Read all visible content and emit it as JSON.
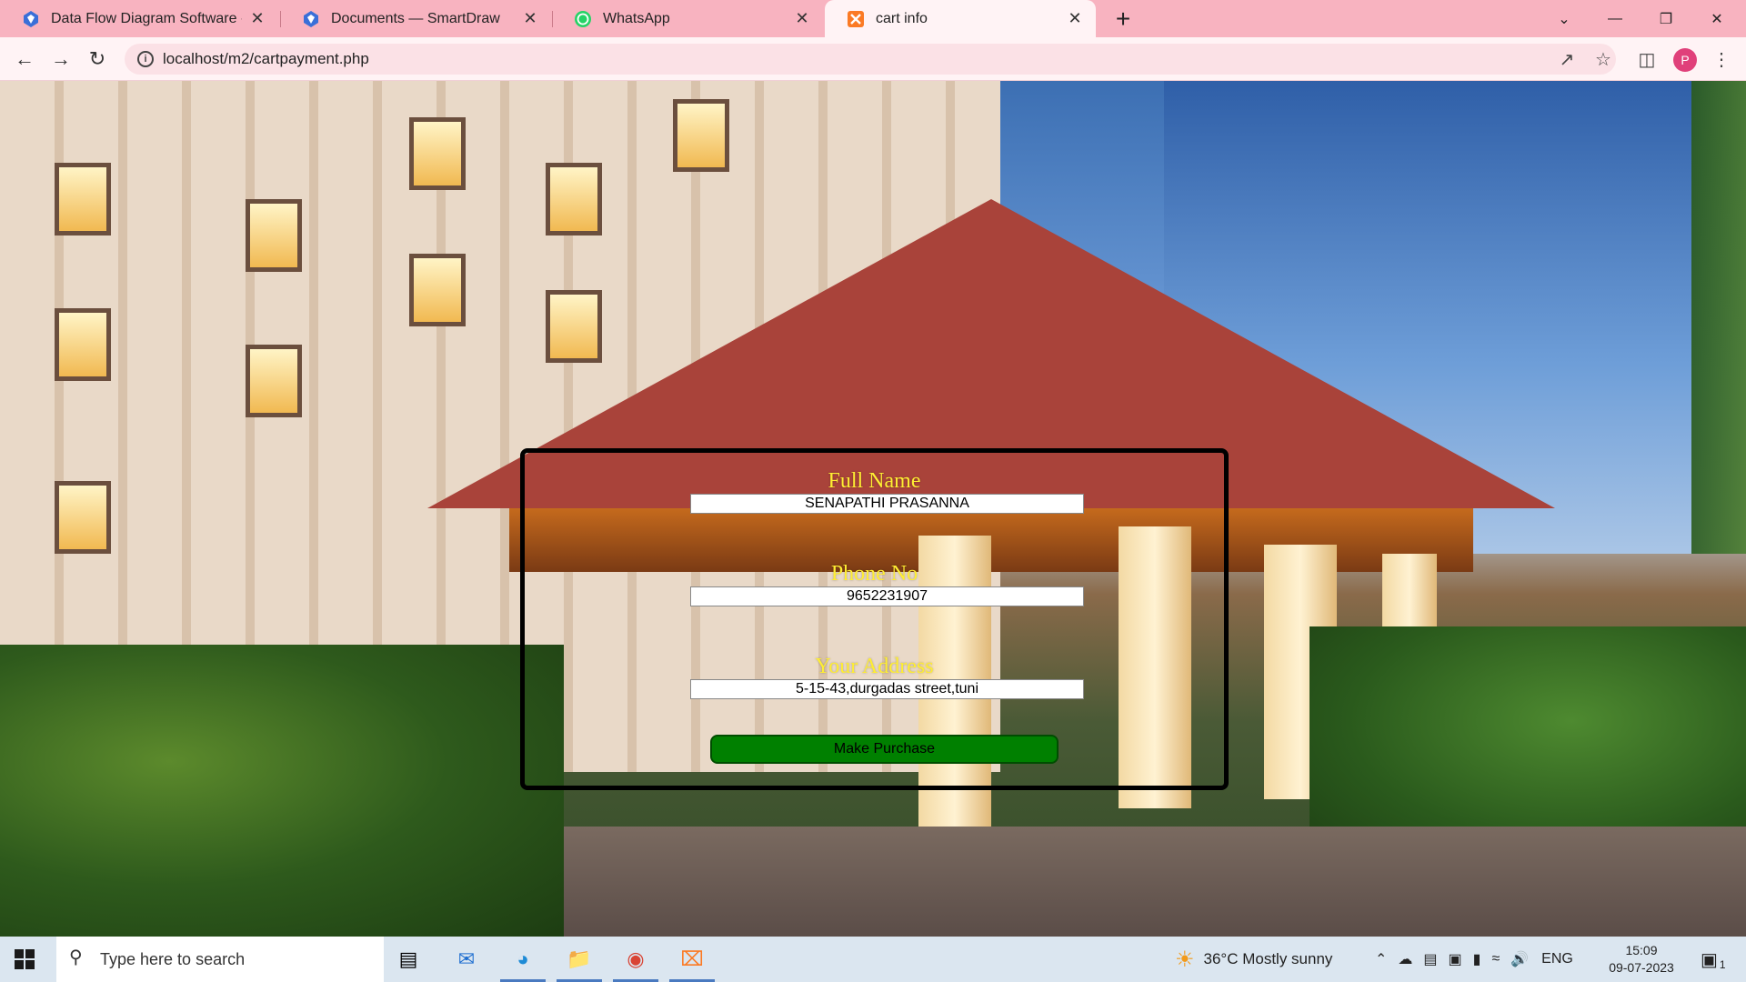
{
  "browser": {
    "tabs": [
      {
        "title": "Data Flow Diagram Software - Fr",
        "icon": "smartdraw-icon",
        "active": false
      },
      {
        "title": "Documents — SmartDraw",
        "icon": "smartdraw-icon",
        "active": false
      },
      {
        "title": "WhatsApp",
        "icon": "whatsapp-icon",
        "active": false
      },
      {
        "title": "cart info",
        "icon": "xampp-icon",
        "active": true
      }
    ],
    "close_glyph": "✕",
    "new_tab_glyph": "+",
    "url": "localhost/m2/cartpayment.php",
    "profile_initial": "P"
  },
  "form": {
    "name_label": "Full Name",
    "name_value": "SENAPATHI PRASANNA",
    "phone_label": "Phone No",
    "phone_value": "9652231907",
    "address_label": "Your Address",
    "address_value": "5-15-43,durgadas street,tuni",
    "submit_label": "Make Purchase"
  },
  "taskbar": {
    "search_placeholder": "Type here to search",
    "weather": "36°C  Mostly sunny",
    "language": "ENG",
    "time": "15:09",
    "date": "09-07-2023",
    "notification_count": "1"
  },
  "colors": {
    "tabstrip": "#f8b3c0",
    "label_yellow": "#ffee33",
    "button_green": "#008000"
  }
}
